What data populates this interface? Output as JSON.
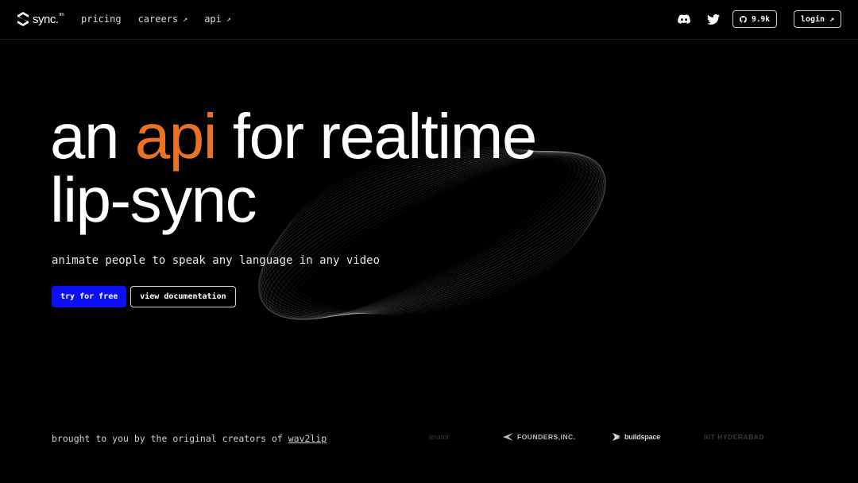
{
  "nav": {
    "logo_text": "sync.",
    "logo_mark": "tm",
    "links": [
      {
        "label": "pricing",
        "external": false
      },
      {
        "label": "careers",
        "external": true
      },
      {
        "label": "api",
        "external": true
      }
    ],
    "external_arrow": "↗",
    "github_stars": "9.9k",
    "login_label": "login",
    "icons": [
      "discord-icon",
      "twitter-icon",
      "github-icon"
    ]
  },
  "hero": {
    "title_before": "an ",
    "title_accent": "api",
    "title_after": " for realtime",
    "title_line2": "lip-sync",
    "tagline": "animate people to speak any language in any video",
    "primary_cta": "try for free",
    "secondary_cta": "view documentation"
  },
  "footer": {
    "credit_text": "brought to you by the original creators of ",
    "credit_link": "wav2lip",
    "partners": [
      "lerator",
      "FOUNDERS,INC.",
      "buildspace",
      "IIIT HYDERABAD"
    ]
  },
  "colors": {
    "background": "#000000",
    "accent": "#ea7223",
    "primary_button": "#0a10f0"
  }
}
